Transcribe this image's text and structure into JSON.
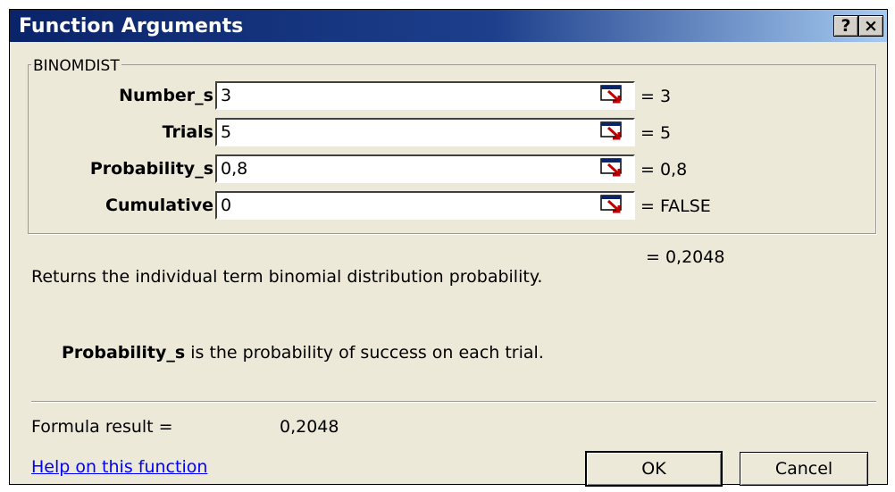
{
  "window": {
    "title": "Function Arguments",
    "help_glyph": "?",
    "close_glyph": "×"
  },
  "group": {
    "legend": "BINOMDIST"
  },
  "args": [
    {
      "label": "Number_s",
      "value": "3",
      "result": "= 3"
    },
    {
      "label": "Trials",
      "value": "5",
      "result": "= 5"
    },
    {
      "label": "Probability_s",
      "value": "0,8",
      "result": "= 0,8"
    },
    {
      "label": "Cumulative",
      "value": "0",
      "result": "= FALSE"
    }
  ],
  "function_result": "= 0,2048",
  "description": "Returns the individual term binomial distribution probability.",
  "arg_help": {
    "name": "Probability_s",
    "text": " is the probability of success on each trial."
  },
  "formula": {
    "label": "Formula result =",
    "value": "0,2048"
  },
  "help_link": "Help on this function",
  "buttons": {
    "ok": "OK",
    "cancel": "Cancel"
  },
  "colors": {
    "titlebar_start": "#0a246a",
    "titlebar_end": "#a6caf0",
    "dialog_bg": "#ece9d8",
    "link": "#0000ff"
  },
  "icons": {
    "collapse": "range-collapse-icon"
  }
}
